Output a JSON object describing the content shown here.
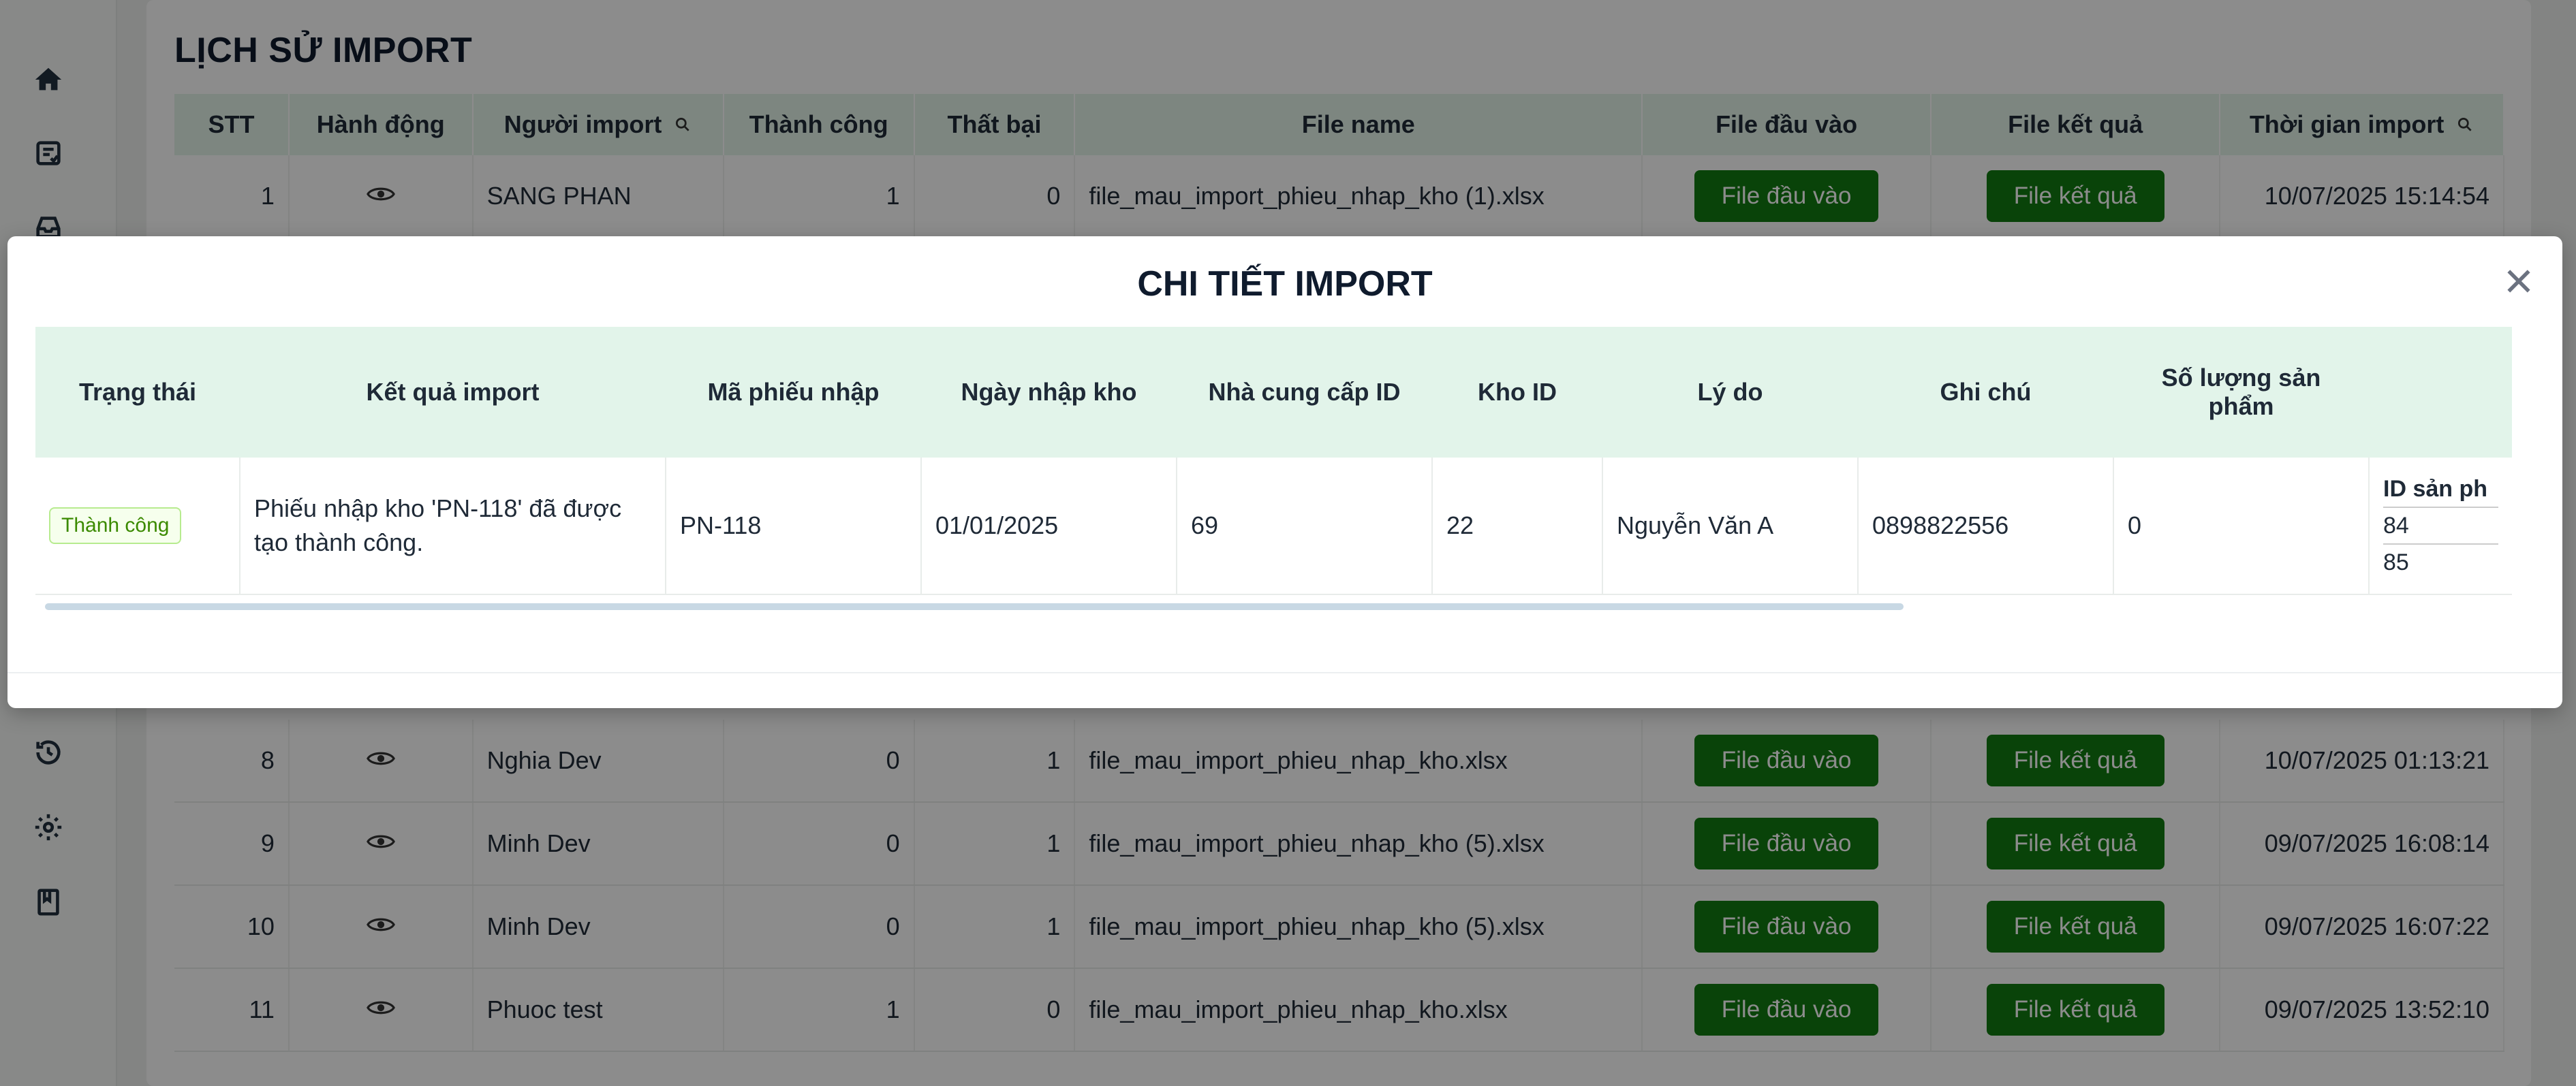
{
  "sidebar": {
    "icons": [
      "home-icon",
      "import-icon",
      "inbox-icon",
      "history-icon",
      "settings-icon",
      "book-icon"
    ]
  },
  "page": {
    "title": "LỊCH SỬ IMPORT"
  },
  "history_table": {
    "headers": {
      "stt": "STT",
      "action": "Hành động",
      "importer": "Người import",
      "success": "Thành công",
      "failed": "Thất bại",
      "file_name": "File name",
      "input_file": "File đầu vào",
      "result_file": "File kết quả",
      "import_time": "Thời gian import"
    },
    "rows": [
      {
        "stt": "1",
        "importer": "SANG PHAN",
        "success": "1",
        "failed": "0",
        "file": "file_mau_import_phieu_nhap_kho (1).xlsx",
        "time": "10/07/2025 15:14:54"
      },
      {
        "stt": "8",
        "importer": "Nghia Dev",
        "success": "0",
        "failed": "1",
        "file": "file_mau_import_phieu_nhap_kho.xlsx",
        "time": "10/07/2025 01:13:21"
      },
      {
        "stt": "9",
        "importer": "Minh Dev",
        "success": "0",
        "failed": "1",
        "file": "file_mau_import_phieu_nhap_kho (5).xlsx",
        "time": "09/07/2025 16:08:14"
      },
      {
        "stt": "10",
        "importer": "Minh Dev",
        "success": "0",
        "failed": "1",
        "file": "file_mau_import_phieu_nhap_kho (5).xlsx",
        "time": "09/07/2025 16:07:22"
      },
      {
        "stt": "11",
        "importer": "Phuoc test",
        "success": "1",
        "failed": "0",
        "file": "file_mau_import_phieu_nhap_kho.xlsx",
        "time": "09/07/2025 13:52:10"
      }
    ],
    "btn_input": "File đầu vào",
    "btn_result": "File kết quả"
  },
  "modal": {
    "title": "CHI TIẾT IMPORT",
    "headers": {
      "status": "Trạng thái",
      "result": "Kết quả import",
      "receipt_code": "Mã phiếu nhập",
      "import_date": "Ngày nhập kho",
      "supplier_id": "Nhà cung cấp ID",
      "warehouse_id": "Kho ID",
      "reason": "Lý do",
      "note": "Ghi chú",
      "qty": "Số lượng sản phẩm"
    },
    "row": {
      "status": "Thành công",
      "result": "Phiếu nhập kho 'PN-118' đã được tạo thành công.",
      "receipt_code": "PN-118",
      "import_date": "01/01/2025",
      "supplier_id": "69",
      "warehouse_id": "22",
      "reason": "Nguyễn Văn A",
      "note": "0898822556",
      "qty": "0",
      "product_id_header": "ID sản ph",
      "product_ids": [
        "84",
        "85"
      ]
    }
  },
  "colors": {
    "accent_green": "#127a12",
    "header_bg": "#e2f4ea",
    "success_tag": "#3b8a00"
  }
}
